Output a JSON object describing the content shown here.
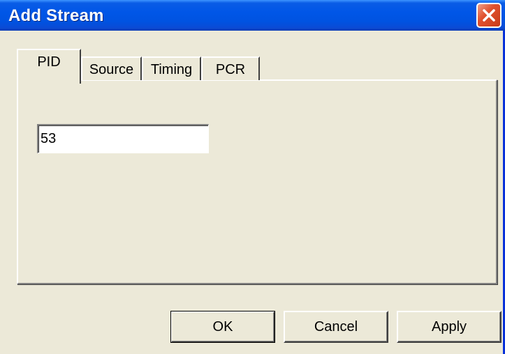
{
  "window": {
    "title": "Add Stream",
    "close_icon": "close-icon"
  },
  "tabs": [
    {
      "label": "PID",
      "active": true
    },
    {
      "label": "Source",
      "active": false
    },
    {
      "label": "Timing",
      "active": false
    },
    {
      "label": "PCR",
      "active": false
    }
  ],
  "pid_field": {
    "value": "53"
  },
  "buttons": {
    "ok": "OK",
    "cancel": "Cancel",
    "apply": "Apply"
  },
  "colors": {
    "titlebar": "#0054e3",
    "close": "#e0512e",
    "dialog_bg": "#ece9d8"
  }
}
